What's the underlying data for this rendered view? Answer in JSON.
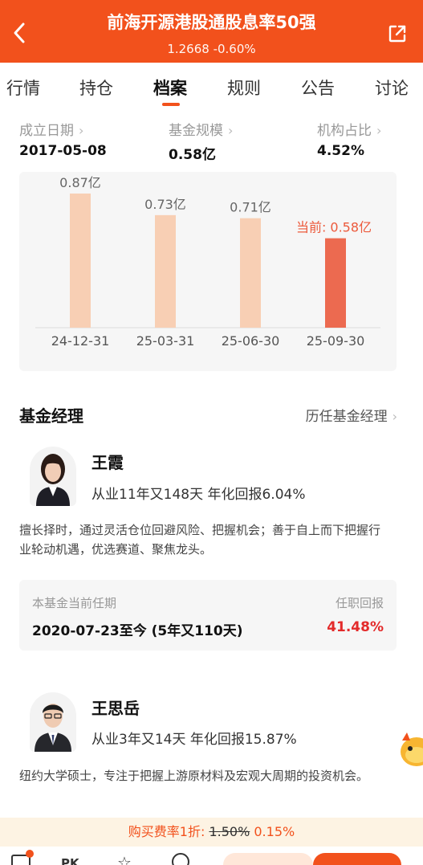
{
  "header": {
    "title": "前海开源港股通股息率50强",
    "subtitle": "1.2668 -0.60%",
    "back_icon": "back-arrow-icon",
    "share_icon": "share-external-icon",
    "bg_color": "#f2511c"
  },
  "tabs": [
    {
      "label": "行情",
      "active": false
    },
    {
      "label": "持仓",
      "active": false
    },
    {
      "label": "档案",
      "active": true
    },
    {
      "label": "规则",
      "active": false
    },
    {
      "label": "公告",
      "active": false
    },
    {
      "label": "讨论",
      "active": false
    }
  ],
  "stats": {
    "established": {
      "label": "成立日期",
      "value": "2017-05-08"
    },
    "scale": {
      "label": "基金规模",
      "value": "0.58亿"
    },
    "institution": {
      "label": "机构占比",
      "value": "4.52%"
    }
  },
  "chart_data": {
    "type": "bar",
    "categories": [
      "24-12-31",
      "25-03-31",
      "25-06-30",
      "25-09-30"
    ],
    "values": [
      0.87,
      0.73,
      0.71,
      0.58
    ],
    "data_labels": [
      "0.87亿",
      "0.73亿",
      "0.71亿",
      "当前: 0.58亿"
    ],
    "unit": "亿",
    "ylim": [
      0,
      1.0
    ],
    "colors": {
      "normal": "#f8cfb4",
      "current": "#ec6a50",
      "current_label": "#ec5a3c"
    }
  },
  "managers_section": {
    "title": "基金经理",
    "history_link": "历任基金经理"
  },
  "managers": [
    {
      "name": "王霞",
      "stat": "从业11年又148天 年化回报6.04%",
      "desc": "擅长择时，通过灵活仓位回避风险、把握机会；善于自上而下把握行业轮动机遇，优选赛道、聚焦龙头。",
      "tenure_label": "本基金当前任期",
      "tenure_value": "2020-07-23至今 (5年又110天)",
      "return_label": "任职回报",
      "return_value": "41.48%"
    },
    {
      "name": "王思岳",
      "stat": "从业3年又14天 年化回报15.87%",
      "desc": "纽约大学硕士，专注于把握上游原材料及宏观大周期的投资机会。"
    }
  ],
  "fee": {
    "prefix": "购买费率1折:",
    "old": "1.50%",
    "new": "0.15%"
  }
}
